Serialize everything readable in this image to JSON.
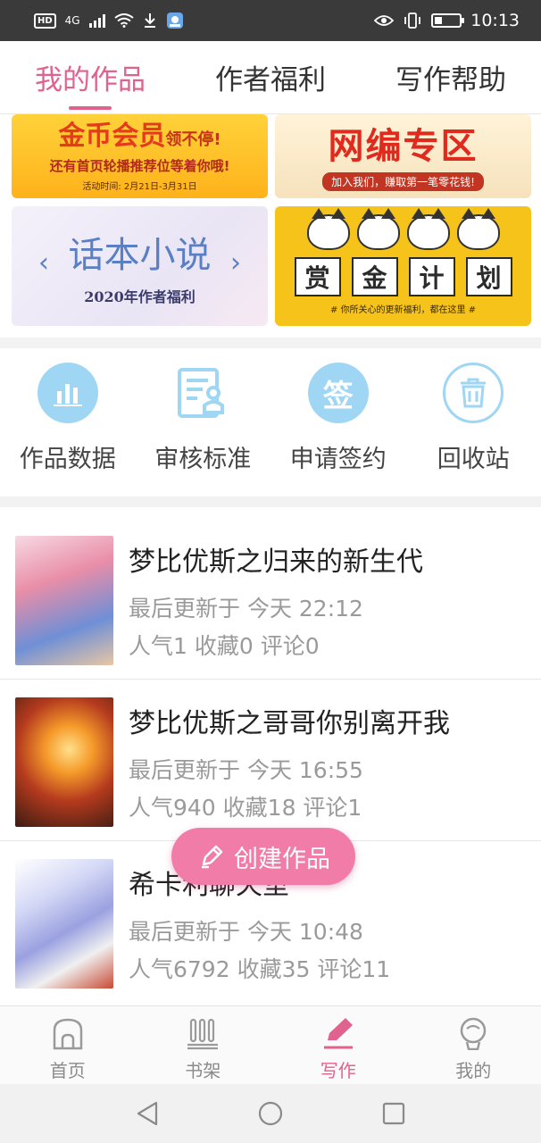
{
  "status_bar": {
    "network_label": "4G",
    "hd_label": "HD",
    "time": "10:13"
  },
  "top_tabs": [
    {
      "label": "我的作品",
      "active": true
    },
    {
      "label": "作者福利",
      "active": false
    },
    {
      "label": "写作帮助",
      "active": false
    }
  ],
  "banners": {
    "coin": {
      "title_main": "金币",
      "title_highlight": "会员",
      "title_tail": "领不停!",
      "subtitle": "还有首页轮播推荐位等着你哦!",
      "date": "活动时间: 2月21日-3月31日"
    },
    "net": {
      "title": "网编专区",
      "subtitle": "加入我们，赚取第一笔零花钱!"
    },
    "story": {
      "title": "话本小说",
      "subtitle": "2020年作者福利"
    },
    "bounty": {
      "words": [
        "赏",
        "金",
        "计",
        "划"
      ],
      "note": "# 你所关心的更新福利，都在这里 #"
    }
  },
  "quick_actions": [
    {
      "label": "作品数据",
      "icon": "bar-chart-icon"
    },
    {
      "label": "审核标准",
      "icon": "review-doc-icon"
    },
    {
      "label": "申请签约",
      "icon": "sign-icon",
      "icon_char": "签"
    },
    {
      "label": "回收站",
      "icon": "trash-icon"
    }
  ],
  "works": [
    {
      "title": "梦比优斯之归来的新生代",
      "updated": "最后更新于 今天 22:12",
      "stats": "人气1 收藏0 评论0"
    },
    {
      "title": "梦比优斯之哥哥你别离开我",
      "updated": "最后更新于 今天 16:55",
      "stats": "人气940 收藏18 评论1"
    },
    {
      "title": "希卡利聊天室",
      "updated": "最后更新于 今天 10:48",
      "stats": "人气6792 收藏35 评论11"
    }
  ],
  "fab": {
    "label": "创建作品",
    "icon": "pencil-icon"
  },
  "bottom_nav": [
    {
      "label": "首页",
      "icon": "home-icon",
      "active": false
    },
    {
      "label": "书架",
      "icon": "bookshelf-icon",
      "active": false
    },
    {
      "label": "写作",
      "icon": "pen-icon",
      "active": true
    },
    {
      "label": "我的",
      "icon": "profile-icon",
      "active": false
    }
  ],
  "colors": {
    "accent_pink": "#e0628f",
    "fab_pink": "#f27ca8",
    "icon_blue": "#9fd6f4",
    "status_bar_bg": "#3a3a3a"
  }
}
